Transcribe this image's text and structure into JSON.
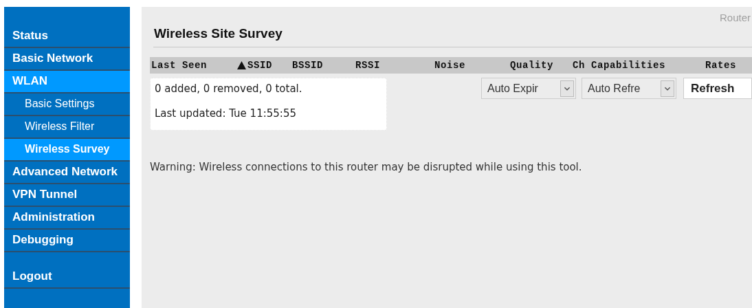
{
  "sidebar": {
    "items": [
      {
        "label": "Status",
        "selected": false
      },
      {
        "label": "Basic Network",
        "selected": false
      },
      {
        "label": "WLAN",
        "selected": true,
        "children": [
          {
            "label": "Basic Settings",
            "selected": false
          },
          {
            "label": "Wireless Filter",
            "selected": false
          },
          {
            "label": "Wireless Survey",
            "selected": true
          }
        ]
      },
      {
        "label": "Advanced Network",
        "selected": false
      },
      {
        "label": "VPN Tunnel",
        "selected": false
      },
      {
        "label": "Administration",
        "selected": false
      },
      {
        "label": "Debugging",
        "selected": false
      }
    ],
    "logout": "Logout"
  },
  "header_text": "Router",
  "title": "Wireless Site Survey",
  "table": {
    "columns": [
      {
        "label": "Last Seen",
        "sorted": false
      },
      {
        "label": "SSID",
        "sorted": true
      },
      {
        "label": "BSSID",
        "sorted": false
      },
      {
        "label": "RSSI",
        "sorted": false
      },
      {
        "label": "Noise",
        "sorted": false
      },
      {
        "label": "Quality",
        "sorted": false
      },
      {
        "label": "Ch",
        "sorted": false
      },
      {
        "label": "Capabilities",
        "sorted": false
      },
      {
        "label": "Rates",
        "sorted": false
      }
    ]
  },
  "status": {
    "summary": "0 added, 0 removed, 0 total.",
    "last_updated": "Last updated: Tue 11:55:55"
  },
  "controls": {
    "expire_select": "Auto Expir",
    "refresh_select": "Auto Refre",
    "refresh_button": "Refresh"
  },
  "warning": "Warning: Wireless connections to this router may be disrupted while using this tool."
}
